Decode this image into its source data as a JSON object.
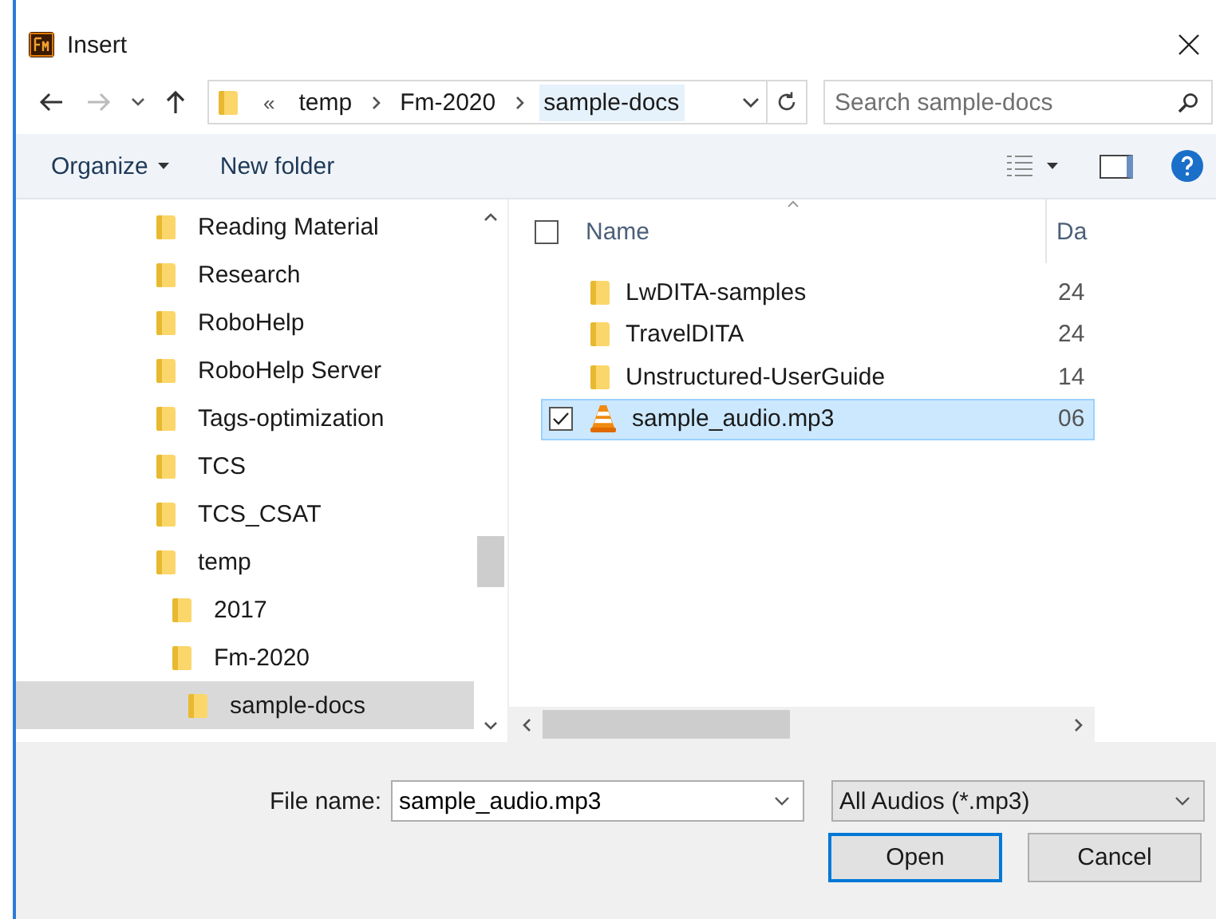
{
  "window": {
    "title": "Insert"
  },
  "address": {
    "overflow": "«",
    "crumbs": [
      {
        "label": "temp",
        "selected": false
      },
      {
        "label": "Fm-2020",
        "selected": false
      },
      {
        "label": "sample-docs",
        "selected": true
      }
    ]
  },
  "search": {
    "placeholder": "Search sample-docs"
  },
  "toolbar": {
    "organize": "Organize",
    "new_folder": "New folder"
  },
  "tree": [
    {
      "label": "Reading Material",
      "selected": false
    },
    {
      "label": "Research",
      "selected": false
    },
    {
      "label": "RoboHelp",
      "selected": false
    },
    {
      "label": "RoboHelp Server",
      "selected": false
    },
    {
      "label": "Tags-optimization",
      "selected": false
    },
    {
      "label": "TCS",
      "selected": false
    },
    {
      "label": "TCS_CSAT",
      "selected": false
    },
    {
      "label": "temp",
      "selected": false,
      "children": [
        {
          "label": "2017",
          "selected": false
        },
        {
          "label": "Fm-2020",
          "selected": false,
          "children": [
            {
              "label": "sample-docs",
              "selected": true
            }
          ]
        }
      ]
    }
  ],
  "files": {
    "header": {
      "name": "Name",
      "column_2": "Da",
      "checked": false
    },
    "rows": [
      {
        "kind": "folder",
        "name": "LwDITA-samples",
        "date": "24",
        "selected": false,
        "checked": false
      },
      {
        "kind": "folder",
        "name": "TravelDITA",
        "date": "24",
        "selected": false,
        "checked": false
      },
      {
        "kind": "folder",
        "name": "Unstructured-UserGuide",
        "date": "14",
        "selected": false,
        "checked": false
      },
      {
        "kind": "audio",
        "name": "sample_audio.mp3",
        "date": "06",
        "selected": true,
        "checked": true
      }
    ]
  },
  "footer": {
    "file_name_label": "File name:",
    "file_name": "sample_audio.mp3",
    "filter": "All Audios (*.mp3)",
    "buttons": [
      {
        "label": "Open",
        "kind": "default"
      },
      {
        "label": "Cancel",
        "kind": "normal"
      }
    ]
  }
}
